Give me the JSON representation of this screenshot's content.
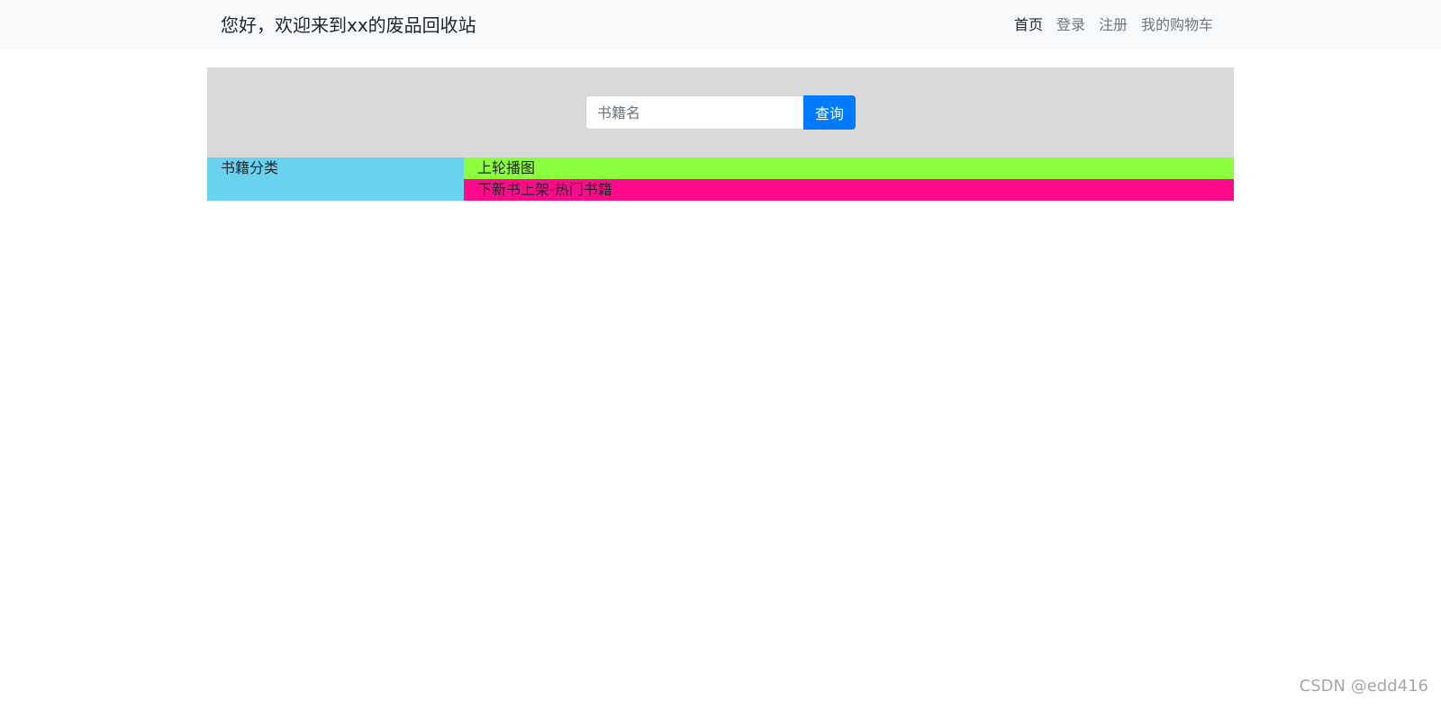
{
  "header": {
    "brand": "您好，欢迎来到xx的废品回收站",
    "nav_items": [
      {
        "label": "首页",
        "active": true
      },
      {
        "label": "登录",
        "active": false
      },
      {
        "label": "注册",
        "active": false
      },
      {
        "label": "我的购物车",
        "active": false
      }
    ]
  },
  "search": {
    "placeholder": "书籍名",
    "button_label": "查询"
  },
  "sections": {
    "category_title": "书籍分类",
    "carousel_label": "上轮播图",
    "hot_label": "下新书上架-热门书籍"
  },
  "watermark": "CSDN @edd416",
  "colors": {
    "navbar_bg": "#f8f9fa",
    "search_band_bg": "#d9d9d9",
    "category_bg": "#69d2ef",
    "carousel_bg": "#8bff3d",
    "hot_bg": "#ff0a8a",
    "primary_button": "#007bff"
  }
}
